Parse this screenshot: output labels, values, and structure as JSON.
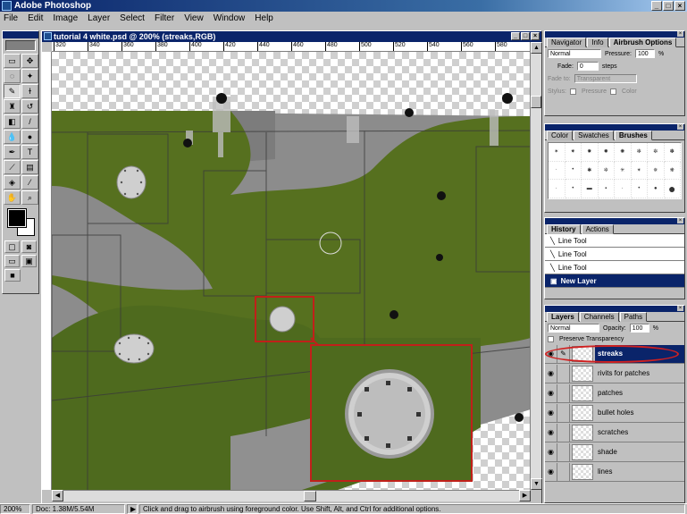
{
  "app": {
    "title": "Adobe Photoshop"
  },
  "menu": [
    "File",
    "Edit",
    "Image",
    "Layer",
    "Select",
    "Filter",
    "View",
    "Window",
    "Help"
  ],
  "document": {
    "title": "tutorial 4 white.psd @ 200% (streaks,RGB)",
    "ruler_ticks": [
      "320",
      "340",
      "360",
      "380",
      "400",
      "420",
      "440",
      "460",
      "480",
      "500",
      "520",
      "540",
      "560",
      "580"
    ]
  },
  "toolbox": {
    "tools": [
      "marquee",
      "move",
      "lasso",
      "magic-wand",
      "airbrush",
      "paintbrush",
      "rubber-stamp",
      "history-brush",
      "eraser",
      "pencil",
      "blur",
      "dodge",
      "pen",
      "type",
      "measure",
      "gradient",
      "paint-bucket",
      "eyedropper",
      "hand",
      "zoom"
    ],
    "active_tool": "airbrush",
    "foreground_color": "#000000",
    "background_color": "#ffffff"
  },
  "navigator_palette": {
    "tabs": [
      "Navigator",
      "Info",
      "Airbrush Options"
    ],
    "mode": "Normal",
    "pressure_label": "Pressure:",
    "pressure_value": "100",
    "pressure_unit": "%",
    "fade_label": "Fade:",
    "fade_value": "0",
    "fade_unit": "steps",
    "fade_to_label": "Fade to:",
    "fade_to_value": "Transparent",
    "stylus_label": "Stylus:",
    "stylus_pressure": "Pressure",
    "stylus_color": "Color"
  },
  "brushes_palette": {
    "tabs": [
      "Color",
      "Swatches",
      "Brushes"
    ],
    "brush_sizes": [
      "",
      "",
      "",
      "",
      "",
      "",
      "",
      "",
      "",
      "",
      "",
      "",
      "",
      "",
      "",
      "",
      "",
      "",
      "",
      "",
      "",
      "",
      "",
      ""
    ]
  },
  "history_palette": {
    "tabs": [
      "History",
      "Actions"
    ],
    "items": [
      "Line Tool",
      "Line Tool",
      "Line Tool",
      "New Layer"
    ]
  },
  "layers_palette": {
    "tabs": [
      "Layers",
      "Channels",
      "Paths"
    ],
    "blend_mode": "Normal",
    "opacity_label": "Opacity:",
    "opacity_value": "100",
    "opacity_unit": "%",
    "preserve_label": "Preserve Transparency",
    "layers": [
      {
        "name": "streaks",
        "selected": true
      },
      {
        "name": "rivits for patches",
        "selected": false
      },
      {
        "name": "patches",
        "selected": false
      },
      {
        "name": "bullet holes",
        "selected": false
      },
      {
        "name": "scratches",
        "selected": false
      },
      {
        "name": "shade",
        "selected": false
      },
      {
        "name": "lines",
        "selected": false
      }
    ]
  },
  "status": {
    "zoom": "200%",
    "doc_size": "Doc: 1.38M/5.54M",
    "hint": "Click and drag to airbrush using foreground color. Use Shift, Alt, and Ctrl for additional options."
  },
  "colors": {
    "green": "#4e6a1e",
    "gray": "#8a8a8a",
    "highlight_red": "#c0201a",
    "titlebar": "#0a246a"
  }
}
